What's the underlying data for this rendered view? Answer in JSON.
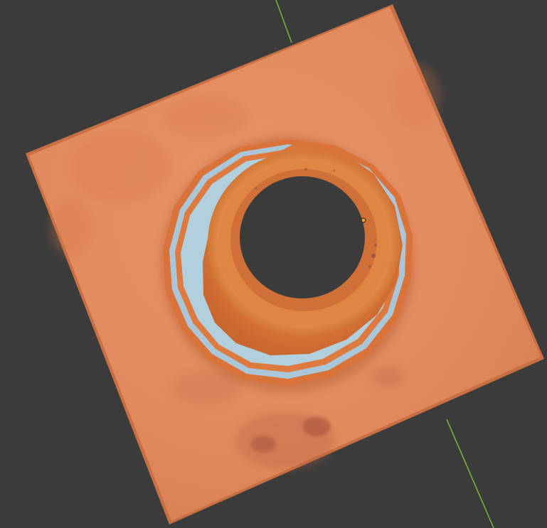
{
  "viewport": {
    "background": "#3b3b3b",
    "y_axis_color": "#79b83a"
  },
  "model": {
    "description_name": "traffic-cone-on-square-base",
    "base_color": "#e0865a",
    "base_edge_color": "#c86f44",
    "cone_orange": "#e17a3b",
    "cone_stripe_color": "#a9c7d8",
    "hole_color": "#3b3b3b",
    "origin_marker_color": "#f0a030"
  }
}
